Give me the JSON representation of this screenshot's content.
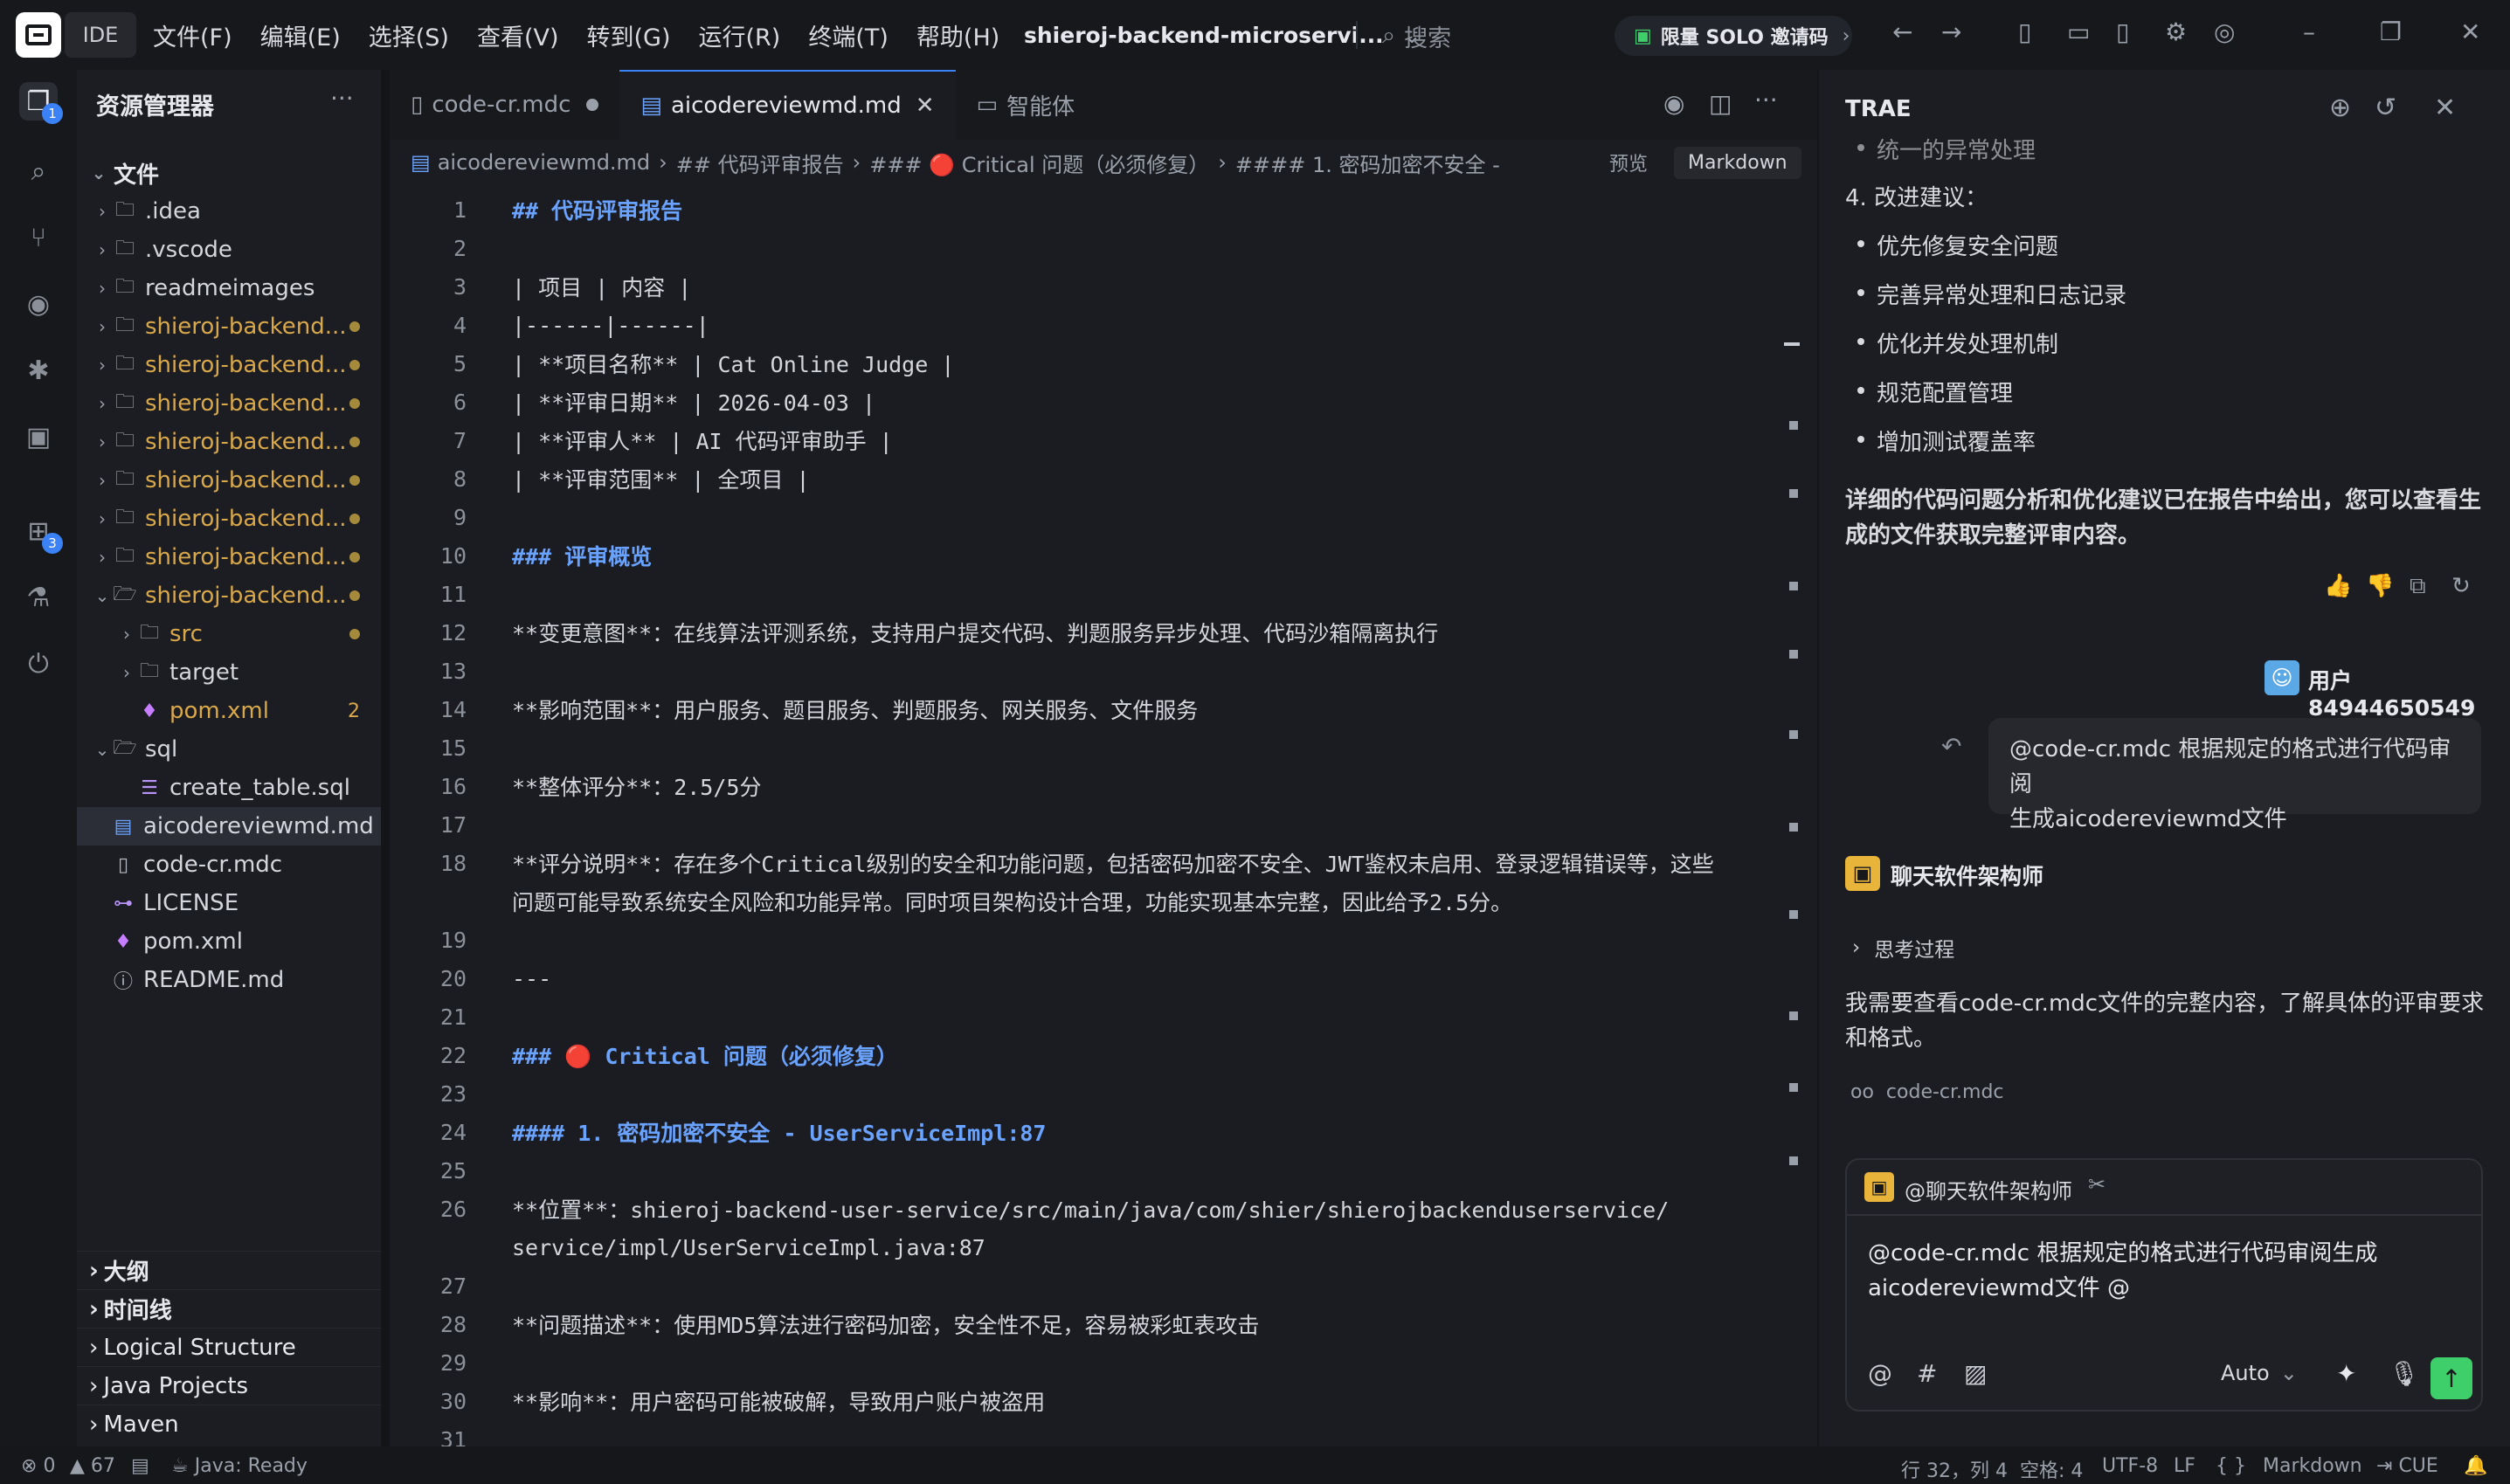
{
  "titlebar": {
    "ide_label": "IDE",
    "menu": [
      "文件(F)",
      "编辑(E)",
      "选择(S)",
      "查看(V)",
      "转到(G)",
      "运行(R)",
      "终端(T)",
      "帮助(H)"
    ],
    "project": "shieroj-backend-microservi...",
    "search_placeholder": "搜索",
    "solo_button": "限量 SOLO 邀请码"
  },
  "explorer": {
    "title": "资源管理器",
    "root": "文件",
    "items": [
      {
        "label": ".idea",
        "type": "folder"
      },
      {
        "label": ".vscode",
        "type": "folder"
      },
      {
        "label": "readmeimages",
        "type": "folder"
      },
      {
        "label": "shieroj-backend...",
        "type": "folder"
      },
      {
        "label": "shieroj-backend...",
        "type": "folder"
      },
      {
        "label": "shieroj-backend...",
        "type": "folder"
      },
      {
        "label": "shieroj-backend...",
        "type": "folder"
      },
      {
        "label": "shieroj-backend...",
        "type": "folder"
      },
      {
        "label": "shieroj-backend...",
        "type": "folder"
      },
      {
        "label": "shieroj-backend...",
        "type": "folder"
      },
      {
        "label": "shieroj-backend...",
        "type": "folder-open"
      },
      {
        "label": "src",
        "type": "folder"
      },
      {
        "label": "target",
        "type": "folder"
      },
      {
        "label": "pom.xml",
        "type": "file",
        "count": "2"
      },
      {
        "label": "sql",
        "type": "folder-open"
      },
      {
        "label": "create_table.sql",
        "type": "file"
      },
      {
        "label": "aicodereviewmd.md",
        "type": "file"
      },
      {
        "label": "code-cr.mdc",
        "type": "file"
      },
      {
        "label": "LICENSE",
        "type": "file"
      },
      {
        "label": "pom.xml",
        "type": "file"
      },
      {
        "label": "README.md",
        "type": "file"
      }
    ],
    "sections": [
      "大纲",
      "时间线",
      "Logical Structure",
      "Java Projects",
      "Maven"
    ]
  },
  "activity_badges": {
    "explorer": "1",
    "extensions": "3"
  },
  "editor": {
    "tabs": [
      {
        "label": "code-cr.mdc"
      },
      {
        "label": "aicodereviewmd.md"
      },
      {
        "label": "智能体"
      }
    ],
    "breadcrumb": [
      "aicodereviewmd.md",
      "## 代码评审报告",
      "### 🔴 Critical 问题（必须修复）",
      "#### 1. 密码加密不安全 -"
    ],
    "preview_label": "预览",
    "lang_label": "Markdown",
    "lines": [
      {
        "n": "1",
        "t": "## 代码评审报告",
        "h": true
      },
      {
        "n": "2",
        "t": ""
      },
      {
        "n": "3",
        "t": "| 项目 | 内容 |"
      },
      {
        "n": "4",
        "t": "|------|------|"
      },
      {
        "n": "5",
        "t": "| **项目名称** | Cat Online Judge |"
      },
      {
        "n": "6",
        "t": "| **评审日期** | 2026-04-03 |"
      },
      {
        "n": "7",
        "t": "| **评审人** | AI 代码评审助手 |"
      },
      {
        "n": "8",
        "t": "| **评审范围** | 全项目 |"
      },
      {
        "n": "9",
        "t": ""
      },
      {
        "n": "10",
        "t": "### 评审概览",
        "h": true
      },
      {
        "n": "11",
        "t": ""
      },
      {
        "n": "12",
        "t": "**变更意图**：在线算法评测系统，支持用户提交代码、判题服务异步处理、代码沙箱隔离执行"
      },
      {
        "n": "13",
        "t": ""
      },
      {
        "n": "14",
        "t": "**影响范围**：用户服务、题目服务、判题服务、网关服务、文件服务"
      },
      {
        "n": "15",
        "t": ""
      },
      {
        "n": "16",
        "t": "**整体评分**：2.5/5分"
      },
      {
        "n": "17",
        "t": ""
      },
      {
        "n": "18",
        "t": "**评分说明**：存在多个Critical级别的安全和功能问题，包括密码加密不安全、JWT鉴权未启用、登录逻辑错误等，这些"
      },
      {
        "n": "",
        "t": "问题可能导致系统安全风险和功能异常。同时项目架构设计合理，功能实现基本完整，因此给予2.5分。"
      },
      {
        "n": "19",
        "t": ""
      },
      {
        "n": "20",
        "t": "---"
      },
      {
        "n": "21",
        "t": ""
      },
      {
        "n": "22",
        "t": "### 🔴 Critical 问题（必须修复）",
        "h": true
      },
      {
        "n": "23",
        "t": ""
      },
      {
        "n": "24",
        "t": "#### 1. 密码加密不安全 - UserServiceImpl:87",
        "h": true
      },
      {
        "n": "25",
        "t": ""
      },
      {
        "n": "26",
        "t": "**位置**：shieroj-backend-user-service/src/main/java/com/shier/shierojbackenduserservice/"
      },
      {
        "n": "",
        "t": "service/impl/UserServiceImpl.java:87"
      },
      {
        "n": "27",
        "t": ""
      },
      {
        "n": "28",
        "t": "**问题描述**：使用MD5算法进行密码加密，安全性不足，容易被彩虹表攻击"
      },
      {
        "n": "29",
        "t": ""
      },
      {
        "n": "30",
        "t": "**影响**：用户密码可能被破解，导致用户账户被盗用"
      },
      {
        "n": "31",
        "t": ""
      }
    ]
  },
  "chat": {
    "title": "TRAE",
    "partial_top": "统一的异常处理",
    "suggest_heading": "4. 改进建议：",
    "suggestions": [
      "优先修复安全问题",
      "完善异常处理和日志记录",
      "优化并发处理机制",
      "规范配置管理",
      "增加测试覆盖率"
    ],
    "summary_1": "详细的代码问题分析和优化建议已在报告中给出，您可以查看生",
    "summary_2": "成的文件获取完整评审内容。",
    "user_name": "用户84944650549",
    "user_msg_1": "@code-cr.mdc 根据规定的格式进行代码审阅",
    "user_msg_2": "生成aicodereviewmd文件",
    "agent_name": "聊天软件架构师",
    "thinking_label": "思考过程",
    "reply_1": "我需要查看code-cr.mdc文件的完整内容，了解具体的评审要求",
    "reply_2": "和格式。",
    "file_ref": "code-cr.mdc",
    "input_agent": "@聊天软件架构师",
    "input_text_1": "@code-cr.mdc 根据规定的格式进行代码审阅生成",
    "input_text_2": "aicodereviewmd文件 @",
    "mode": "Auto"
  },
  "statusbar": {
    "errors": "0",
    "warnings": "67",
    "java": "Java: Ready",
    "position": "行 32，列 4",
    "spaces": "空格: 4",
    "encoding": "UTF-8",
    "eol": "LF",
    "braces": "{ }",
    "language": "Markdown",
    "cue": "CUE"
  }
}
